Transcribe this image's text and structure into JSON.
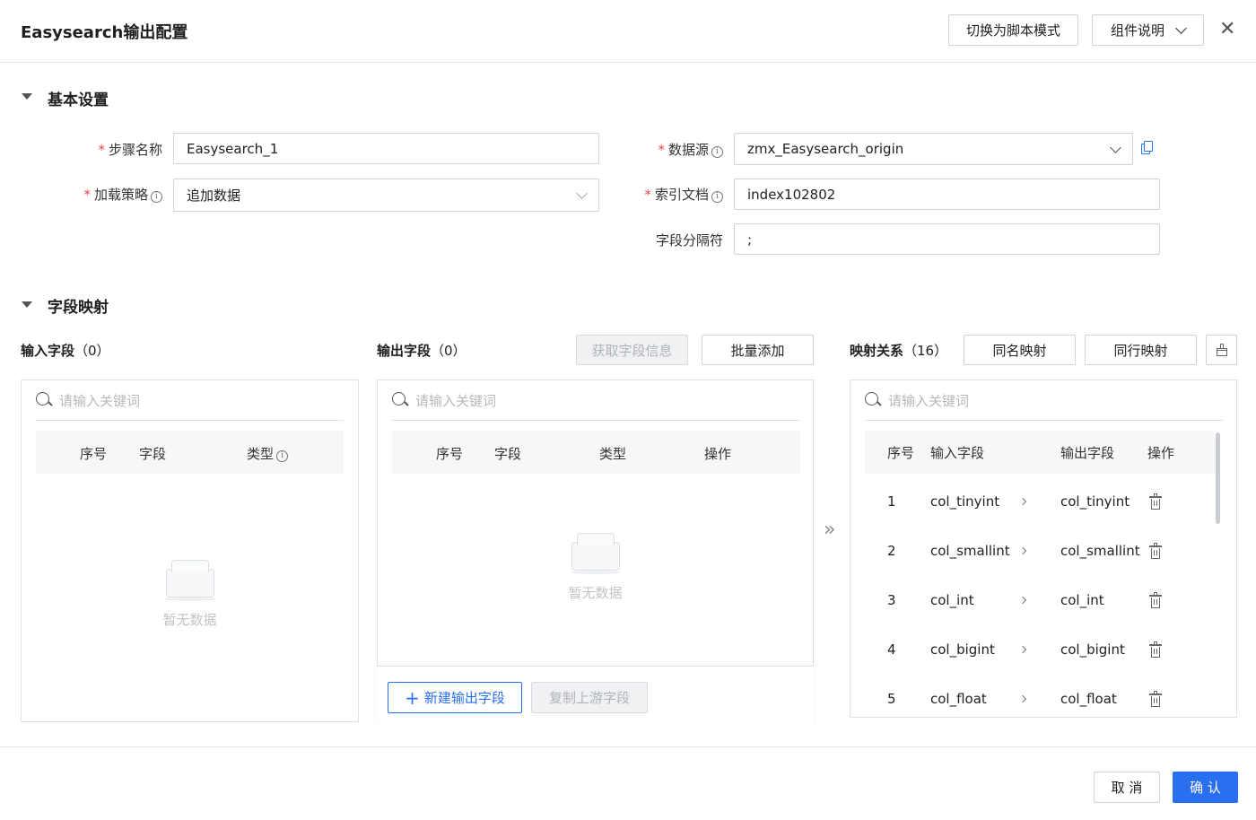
{
  "header": {
    "title": "Easysearch输出配置",
    "script_mode_button": "切换为脚本模式",
    "component_help_button": "组件说明",
    "close_symbol": "✕"
  },
  "basic": {
    "section_title": "基本设置",
    "step_name_label": "步骤名称",
    "step_name_value": "Easysearch_1",
    "load_strategy_label": "加载策略",
    "load_strategy_value": "追加数据",
    "datasource_label": "数据源",
    "datasource_value": "zmx_Easysearch_origin",
    "index_label": "索引文档",
    "index_value": "index102802",
    "separator_label": "字段分隔符",
    "separator_value": ";",
    "info_symbol": "i",
    "required_mark": "*"
  },
  "mapping": {
    "section_title": "字段映射",
    "input_panel": {
      "title": "输入字段",
      "count": "（0）",
      "search_placeholder": "请输入关键词",
      "columns": [
        "序号",
        "字段",
        "类型"
      ],
      "empty_text": "暂无数据"
    },
    "output_panel": {
      "title": "输出字段",
      "count": "（0）",
      "fetch_button": "获取字段信息",
      "batch_add_button": "批量添加",
      "search_placeholder": "请输入关键词",
      "columns": [
        "序号",
        "字段",
        "类型",
        "操作"
      ],
      "empty_text": "暂无数据",
      "new_field_button": "新建输出字段",
      "copy_upstream_button": "复制上游字段",
      "plus_symbol": "+"
    },
    "transfer_symbol": "»",
    "relation_panel": {
      "title": "映射关系",
      "count": "（16）",
      "same_name_button": "同名映射",
      "same_row_button": "同行映射",
      "search_placeholder": "请输入关键词",
      "columns": [
        "序号",
        "输入字段",
        "输出字段",
        "操作"
      ],
      "rows": [
        {
          "no": "1",
          "input": "col_tinyint",
          "output": "col_tinyint"
        },
        {
          "no": "2",
          "input": "col_smallint",
          "output": "col_smallint"
        },
        {
          "no": "3",
          "input": "col_int",
          "output": "col_int"
        },
        {
          "no": "4",
          "input": "col_bigint",
          "output": "col_bigint"
        },
        {
          "no": "5",
          "input": "col_float",
          "output": "col_float"
        }
      ]
    }
  },
  "footer": {
    "cancel_button": "取 消",
    "confirm_button": "确 认"
  },
  "colors": {
    "primary": "#2a6ff0",
    "required": "#e5484d",
    "border": "#d0d3d9"
  }
}
